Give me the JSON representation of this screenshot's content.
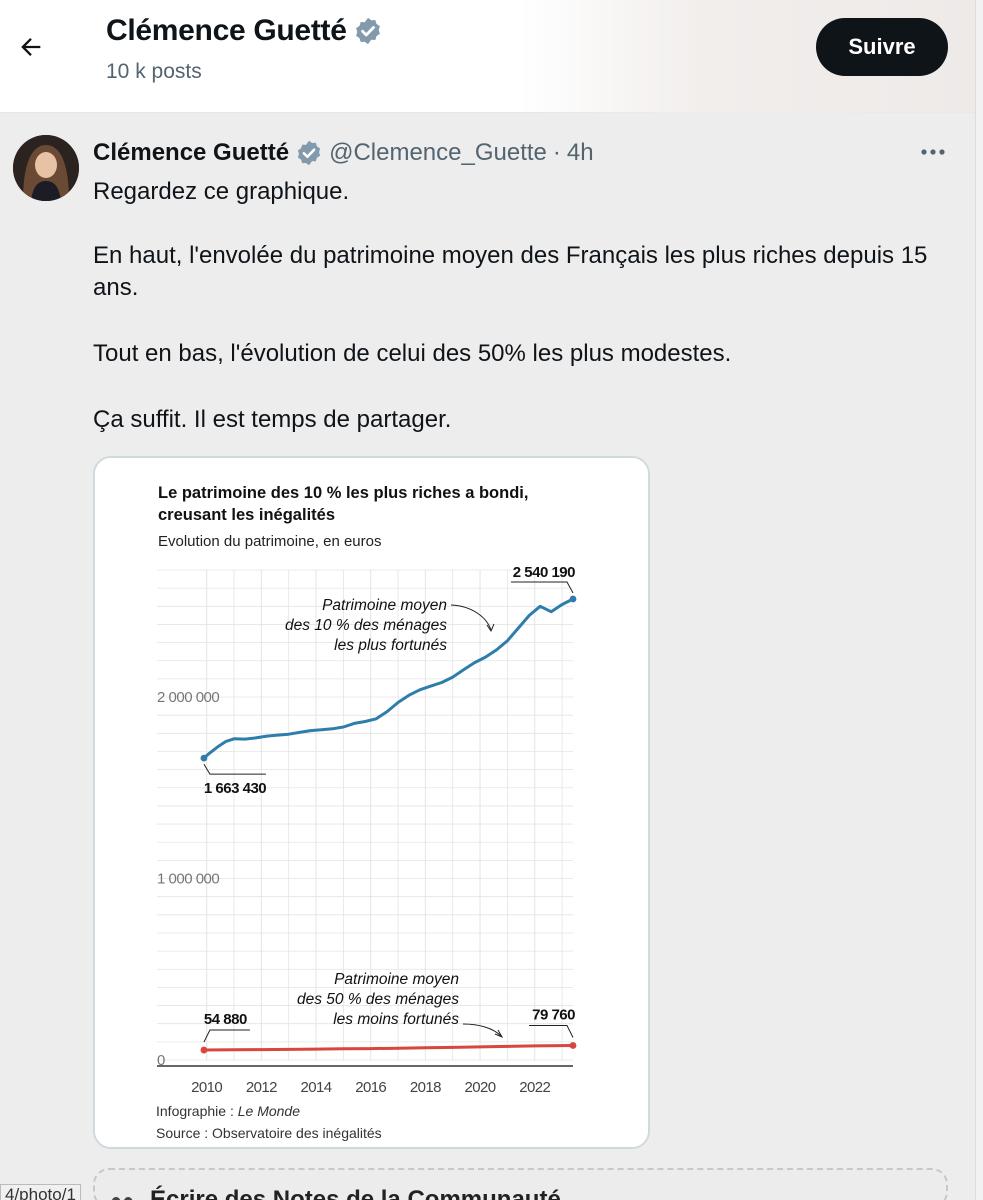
{
  "header": {
    "title": "Clémence Guetté",
    "subtitle": "10 k posts",
    "follow_label": "Suivre"
  },
  "tweet": {
    "author_name": "Clémence Guetté",
    "handle": "@Clemence_Guette",
    "separator": "·",
    "time": "4h",
    "paragraphs": [
      "Regardez ce graphique.",
      "En haut, l'envolée du patrimoine moyen des Français les plus riches depuis 15 ans.",
      "Tout en bas, l'évolution de celui des 50% les plus modestes.",
      "Ça suffit. Il est temps de partager."
    ]
  },
  "icons": {
    "back": "arrow-left-icon",
    "verified": "verified-badge-icon",
    "more": "more-dots-icon"
  },
  "colors": {
    "verified_badge": "#829aab",
    "follow_button": "#0f1419",
    "series_top": "#2e7dab",
    "series_bottom": "#d9453f"
  },
  "chart_data": {
    "type": "line",
    "title": "Le patrimoine des 10 % les plus riches a bondi, creusant les inégalités",
    "subtitle": "Evolution du patrimoine, en euros",
    "xlabel": "",
    "ylabel": "",
    "xlim": [
      2009.5,
      2023.4
    ],
    "ylim": [
      0,
      2700000
    ],
    "x_ticks": [
      "2010",
      "2012",
      "2014",
      "2016",
      "2018",
      "2020",
      "2022"
    ],
    "y_ticks": [
      "0",
      "1 000 000",
      "2 000 000"
    ],
    "grid": true,
    "series": [
      {
        "name": "Patrimoine moyen des 10 % des ménages les plus fortunés",
        "color": "#2e7dab",
        "x": [
          2009.9,
          2010.1,
          2010.4,
          2010.7,
          2011.0,
          2011.4,
          2011.8,
          2012.2,
          2012.6,
          2013.0,
          2013.4,
          2013.8,
          2014.2,
          2014.6,
          2015.0,
          2015.4,
          2015.8,
          2016.2,
          2016.6,
          2017.0,
          2017.4,
          2017.8,
          2018.2,
          2018.6,
          2019.0,
          2019.4,
          2019.8,
          2020.2,
          2020.6,
          2021.0,
          2021.4,
          2021.8,
          2022.2,
          2022.6,
          2023.0,
          2023.4
        ],
        "y": [
          1663430,
          1690000,
          1725000,
          1755000,
          1770000,
          1768000,
          1775000,
          1785000,
          1790000,
          1795000,
          1805000,
          1815000,
          1820000,
          1825000,
          1835000,
          1855000,
          1865000,
          1880000,
          1920000,
          1970000,
          2010000,
          2040000,
          2060000,
          2080000,
          2110000,
          2150000,
          2190000,
          2220000,
          2260000,
          2310000,
          2380000,
          2450000,
          2500000,
          2470000,
          2510000,
          2540190
        ],
        "end_labels": {
          "start": "1 663 430",
          "end": "2 540 190"
        }
      },
      {
        "name": "Patrimoine moyen des 50 % des ménages les moins fortunés",
        "color": "#d9453f",
        "x": [
          2009.9,
          2011,
          2012,
          2013,
          2014,
          2015,
          2016,
          2017,
          2018,
          2019,
          2020,
          2021,
          2022,
          2023.4
        ],
        "y": [
          54880,
          56000,
          57500,
          58500,
          60000,
          61500,
          63000,
          65000,
          67000,
          69500,
          72000,
          75000,
          77500,
          79760
        ],
        "end_labels": {
          "start": "54 880",
          "end": "79 760"
        }
      }
    ],
    "footer_credit_prefix": "Infographie : ",
    "footer_credit_source": "Le Monde",
    "footer_source": "Source : Observatoire des inégalités"
  },
  "bottom_strip": {
    "text": "Écrire des Notes de la Communauté"
  },
  "url_hint": "4/photo/1"
}
